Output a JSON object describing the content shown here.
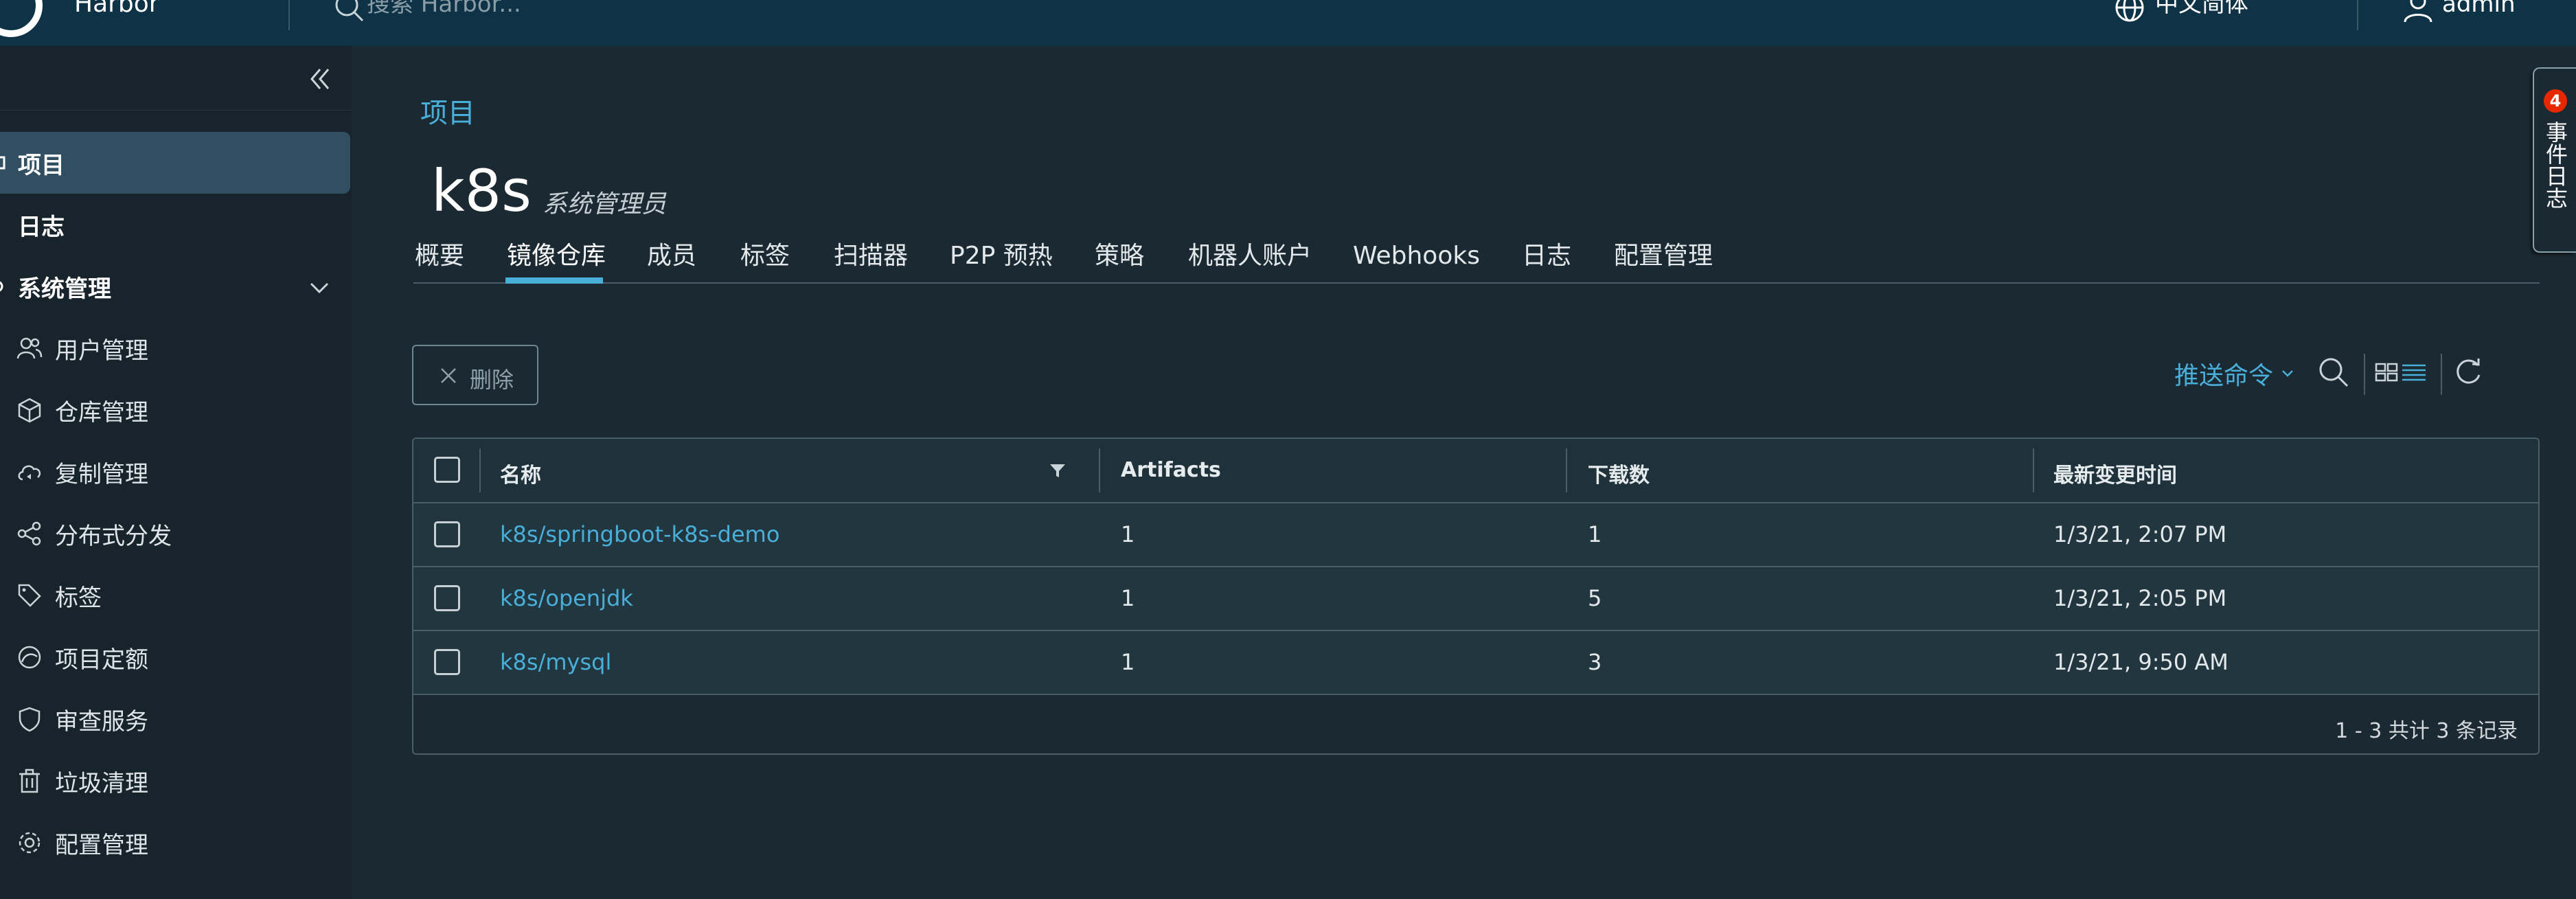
{
  "header": {
    "brand": "Harbor",
    "search_placeholder": "搜索 Harbor...",
    "language": "中文简体",
    "user": "admin"
  },
  "sidebar": {
    "items": [
      {
        "label": "项目",
        "icon": "project-icon",
        "active": true
      },
      {
        "label": "日志",
        "icon": "logs-icon",
        "active": false
      },
      {
        "label": "系统管理",
        "icon": "admin-icon",
        "active": false,
        "expanded": true
      }
    ],
    "admin_items": [
      {
        "label": "用户管理",
        "icon": "users-icon"
      },
      {
        "label": "仓库管理",
        "icon": "box-icon"
      },
      {
        "label": "复制管理",
        "icon": "cloud-sync-icon"
      },
      {
        "label": "分布式分发",
        "icon": "share-icon"
      },
      {
        "label": "标签",
        "icon": "tag-icon"
      },
      {
        "label": "项目定额",
        "icon": "quota-gauge-icon"
      },
      {
        "label": "审查服务",
        "icon": "shield-icon"
      },
      {
        "label": "垃圾清理",
        "icon": "trash-icon"
      },
      {
        "label": "配置管理",
        "icon": "gear-icon"
      }
    ]
  },
  "main": {
    "breadcrumb": "项目",
    "project_name": "k8s",
    "project_role": "系统管理员",
    "tabs": [
      {
        "label": "概要"
      },
      {
        "label": "镜像仓库",
        "active": true
      },
      {
        "label": "成员"
      },
      {
        "label": "标签"
      },
      {
        "label": "扫描器"
      },
      {
        "label": "P2P 预热"
      },
      {
        "label": "策略"
      },
      {
        "label": "机器人账户"
      },
      {
        "label": "Webhooks"
      },
      {
        "label": "日志"
      },
      {
        "label": "配置管理"
      }
    ],
    "toolbar": {
      "delete_label": "删除",
      "push_command": "推送命令"
    },
    "table": {
      "columns": [
        "名称",
        "Artifacts",
        "下载数",
        "最新变更时间"
      ],
      "rows": [
        {
          "name": "k8s/springboot-k8s-demo",
          "artifacts": "1",
          "downloads": "1",
          "updated": "1/3/21, 2:07 PM"
        },
        {
          "name": "k8s/openjdk",
          "artifacts": "1",
          "downloads": "5",
          "updated": "1/3/21, 2:05 PM"
        },
        {
          "name": "k8s/mysql",
          "artifacts": "1",
          "downloads": "3",
          "updated": "1/3/21, 9:50 AM"
        }
      ],
      "footer": "1 - 3 共计 3 条记录"
    }
  },
  "event_log": {
    "label": "事件日志",
    "count": "4"
  },
  "colors": {
    "header_bg": "#0e3246",
    "sidebar_bg": "#17242b",
    "content_bg": "#1b2a32",
    "accent": "#49afd9",
    "badge": "#e62700"
  }
}
